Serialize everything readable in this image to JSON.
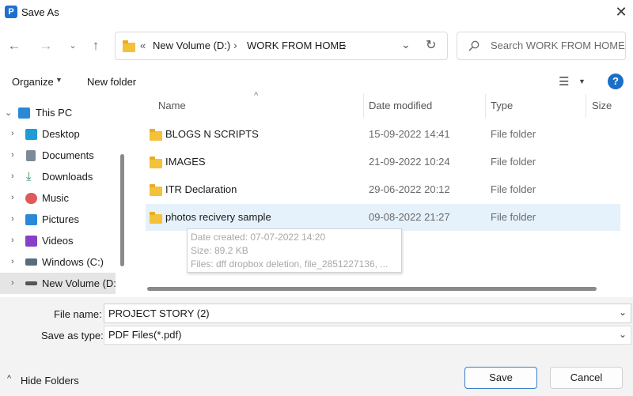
{
  "window": {
    "title": "Save As",
    "app_icon_letter": "P"
  },
  "address_bar": {
    "overflow": "«",
    "path": [
      "New Volume (D:)",
      "WORK FROM HOME"
    ],
    "separator": "›"
  },
  "search": {
    "placeholder": "Search WORK FROM HOME"
  },
  "toolbar": {
    "organize": "Organize",
    "new_folder": "New folder"
  },
  "sidebar": {
    "items": [
      {
        "label": "This PC",
        "icon": "this-pc-icon",
        "color": "#2b88d8"
      },
      {
        "label": "Desktop",
        "icon": "desktop-icon",
        "color": "#1f9bd6"
      },
      {
        "label": "Documents",
        "icon": "documents-icon",
        "color": "#7d8a99"
      },
      {
        "label": "Downloads",
        "icon": "downloads-icon",
        "color": "#1e8c5a"
      },
      {
        "label": "Music",
        "icon": "music-icon",
        "color": "#e05a5a"
      },
      {
        "label": "Pictures",
        "icon": "pictures-icon",
        "color": "#2b88d8"
      },
      {
        "label": "Videos",
        "icon": "videos-icon",
        "color": "#8a3fc7"
      },
      {
        "label": "Windows (C:)",
        "icon": "windows-drive-icon",
        "color": "#5a6b7d"
      },
      {
        "label": "New Volume (D:",
        "icon": "drive-icon",
        "color": "#555555"
      }
    ]
  },
  "columns": {
    "name": "Name",
    "date": "Date modified",
    "type": "Type",
    "size": "Size"
  },
  "files": [
    {
      "name": "BLOGS N SCRIPTS",
      "date": "15-09-2022 14:41",
      "type": "File folder"
    },
    {
      "name": "IMAGES",
      "date": "21-09-2022 10:24",
      "type": "File folder"
    },
    {
      "name": "ITR Declaration",
      "date": "29-06-2022 20:12",
      "type": "File folder"
    },
    {
      "name": "photos recivery sample",
      "date": "09-08-2022 21:27",
      "type": "File folder"
    }
  ],
  "tooltip": {
    "created": "Date created: 07-07-2022 14:20",
    "size": "Size: 89.2 KB",
    "files": "Files: dff dropbox deletion, file_2851227136, ..."
  },
  "form": {
    "file_name_label": "File name:",
    "file_name_value": "PROJECT STORY (2)",
    "save_type_label": "Save as type:",
    "save_type_value": "PDF Files(*.pdf)"
  },
  "footer": {
    "hide_folders": "Hide Folders",
    "save": "Save",
    "cancel": "Cancel"
  },
  "colors": {
    "accent": "#3a7fc9",
    "selection": "#e5f1fb",
    "folder": "#f3c13a"
  }
}
